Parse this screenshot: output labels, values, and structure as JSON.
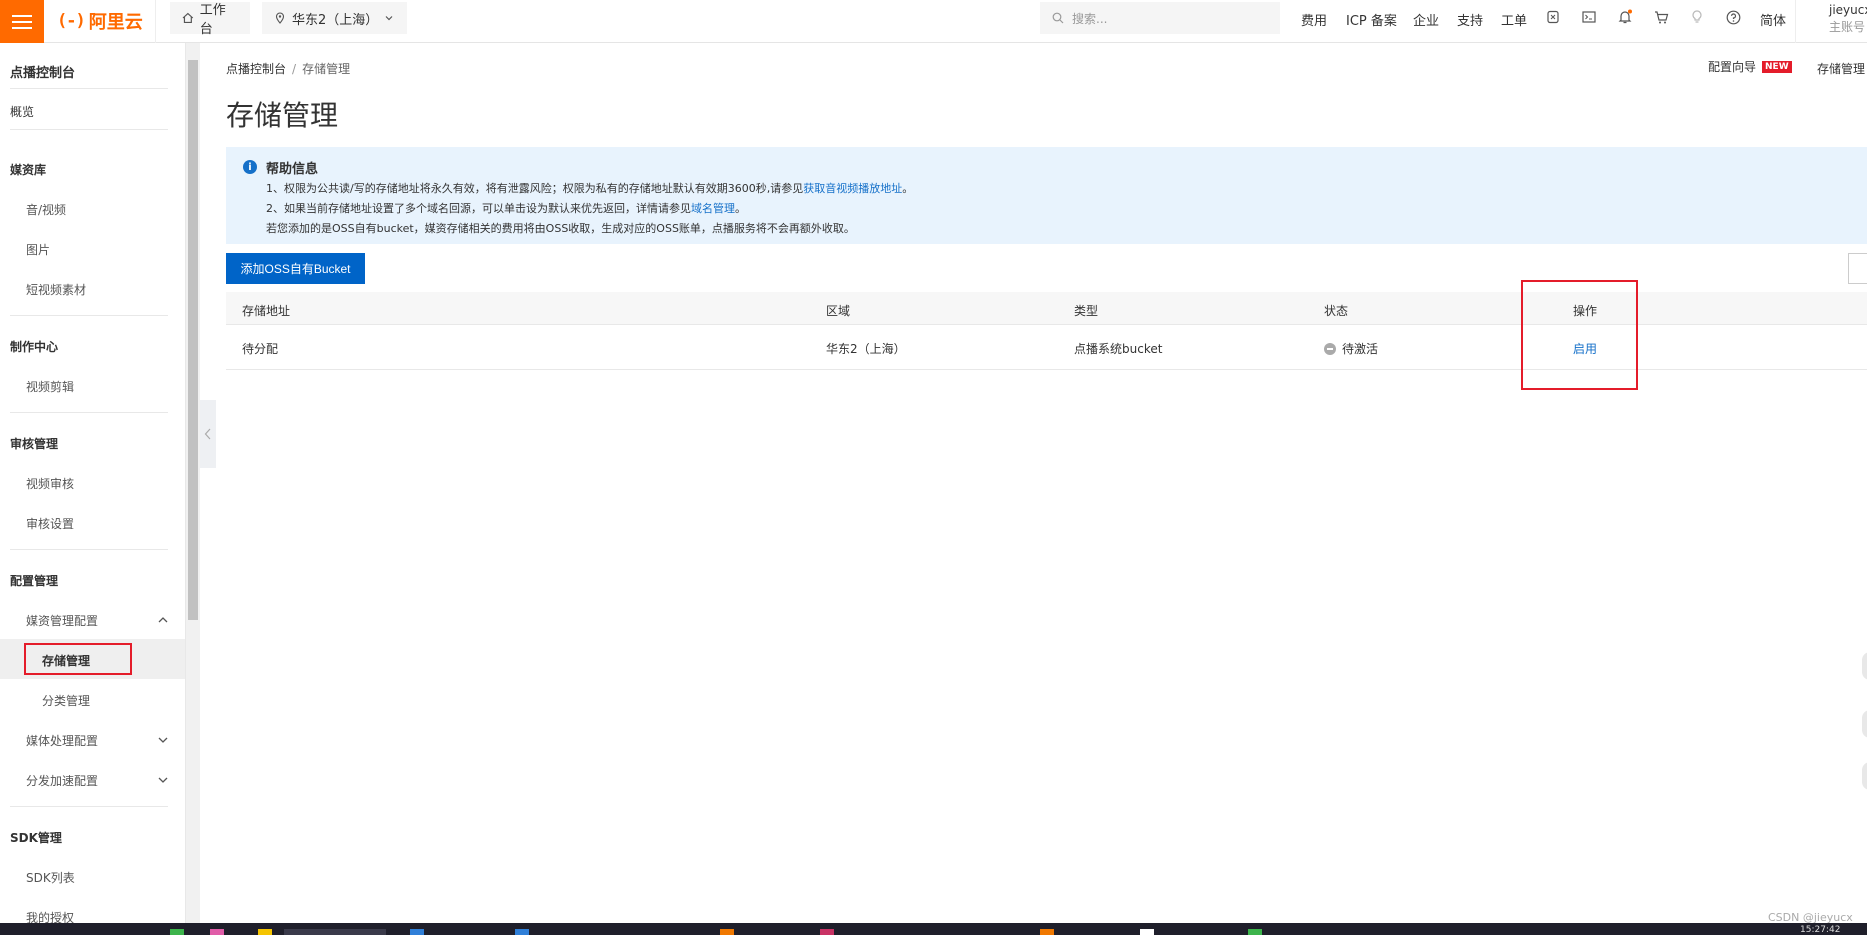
{
  "topbar": {
    "logo": "阿里云",
    "workbench": "工作台",
    "region": "华东2（上海）",
    "search_placeholder": "搜索...",
    "links": [
      "费用",
      "ICP 备案",
      "企业",
      "支持",
      "工单"
    ],
    "lang": "简体",
    "username": "jieyucx",
    "account_type": "主账号"
  },
  "sidebar": {
    "title": "点播控制台",
    "overview": "概览",
    "groups": [
      {
        "label": "媒资库",
        "items": [
          "音/视频",
          "图片",
          "短视频素材"
        ]
      },
      {
        "label": "制作中心",
        "items": [
          "视频剪辑"
        ]
      },
      {
        "label": "审核管理",
        "items": [
          "视频审核",
          "审核设置"
        ]
      },
      {
        "label": "配置管理",
        "items": [
          "媒资管理配置",
          "存储管理",
          "分类管理",
          "媒体处理配置",
          "分发加速配置"
        ]
      },
      {
        "label": "SDK管理",
        "items": [
          "SDK列表",
          "我的授权"
        ]
      }
    ],
    "active_item": "存储管理"
  },
  "breadcrumb": {
    "root": "点播控制台",
    "current": "存储管理"
  },
  "page_title": "存储管理",
  "guide": {
    "label": "配置向导",
    "badge": "NEW"
  },
  "storage_link": "存储管理",
  "help": {
    "title": "帮助信息",
    "line1": "1、权限为公共读/写的存储地址将永久有效，将有泄露风险；权限为私有的存储地址默认有效期3600秒,请参见",
    "line1_link": "获取音视频播放地址",
    "line1_end": "。",
    "line2": "2、如果当前存储地址设置了多个域名回源，可以单击设为默认来优先返回，详情请参见",
    "line2_link": "域名管理",
    "line2_end": "。",
    "line3": "若您添加的是OSS自有bucket，媒资存储相关的费用将由OSS收取，生成对应的OSS账单，点播服务将不会再额外收取。"
  },
  "add_button": "添加OSS自有Bucket",
  "table": {
    "headers": [
      "存储地址",
      "区域",
      "类型",
      "状态",
      "操作"
    ],
    "rows": [
      {
        "address": "待分配",
        "region": "华东2（上海）",
        "type": "点播系统bucket",
        "status": "待激活",
        "action": "启用"
      }
    ]
  },
  "watermark": "CSDN @jieyucx",
  "clock": "15:27:42",
  "colors": {
    "brand": "#ff6a00",
    "primary": "#0064c8",
    "link": "#1570c9",
    "highlight": "#e41c2a"
  }
}
